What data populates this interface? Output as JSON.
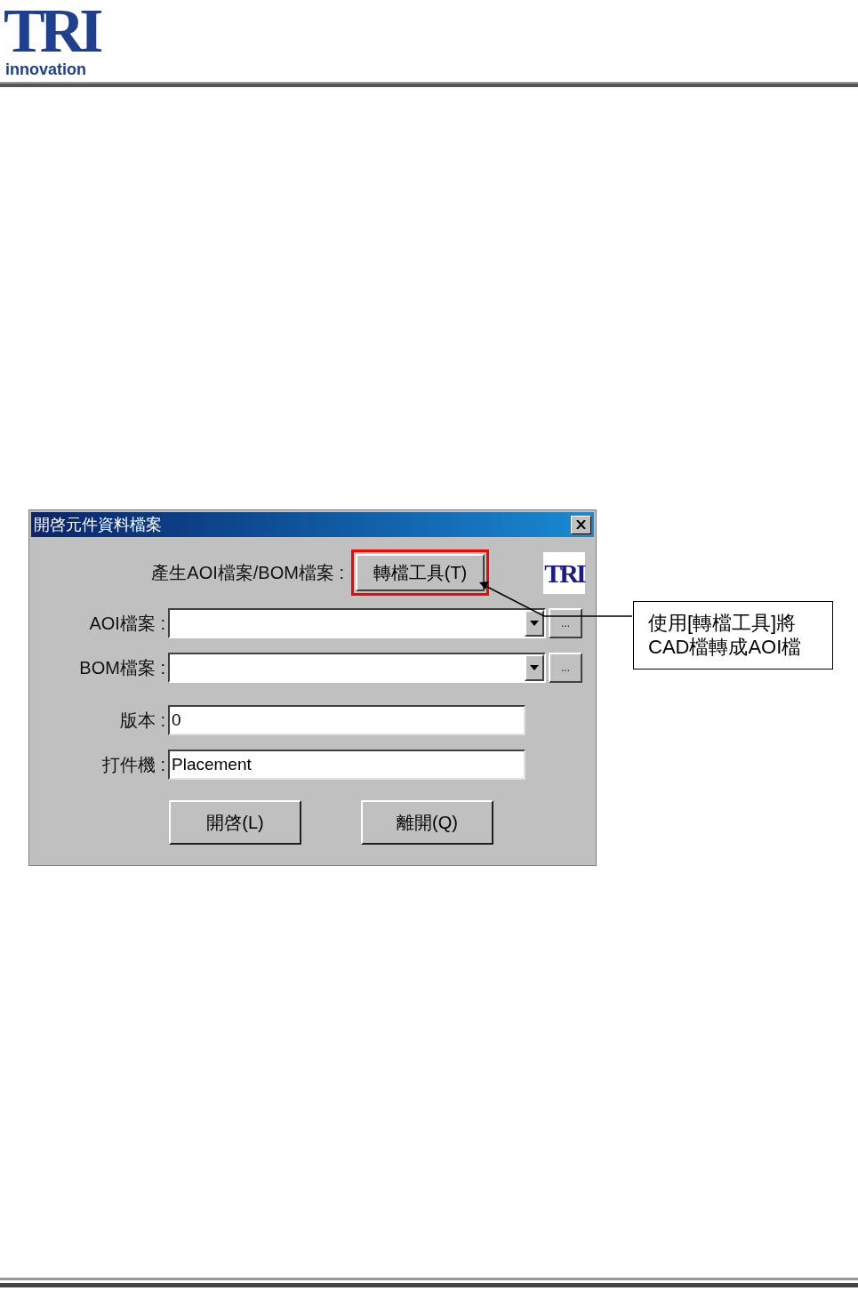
{
  "header": {
    "logo_letters": "TRI",
    "logo_word": "innovation"
  },
  "dialog": {
    "title": "開啓元件資料檔案",
    "convert": {
      "label": "產生AOI檔案/BOM檔案 :",
      "button": "轉檔工具(T)",
      "highlighted": true
    },
    "logo": "TRI",
    "fields": [
      {
        "kind": "combo",
        "label": "AOI檔案 :",
        "browse": "..."
      },
      {
        "kind": "combo",
        "label": "BOM檔案 :",
        "browse": "..."
      },
      {
        "kind": "text",
        "label": "版本 :",
        "value": "0"
      },
      {
        "kind": "text",
        "label": "打件機 :",
        "value": "Placement"
      }
    ],
    "buttons": [
      "開啓(L)",
      "離開(Q)"
    ]
  },
  "callout": {
    "lines": [
      "使用[轉檔工具]將",
      "CAD檔轉成AOI檔"
    ]
  }
}
